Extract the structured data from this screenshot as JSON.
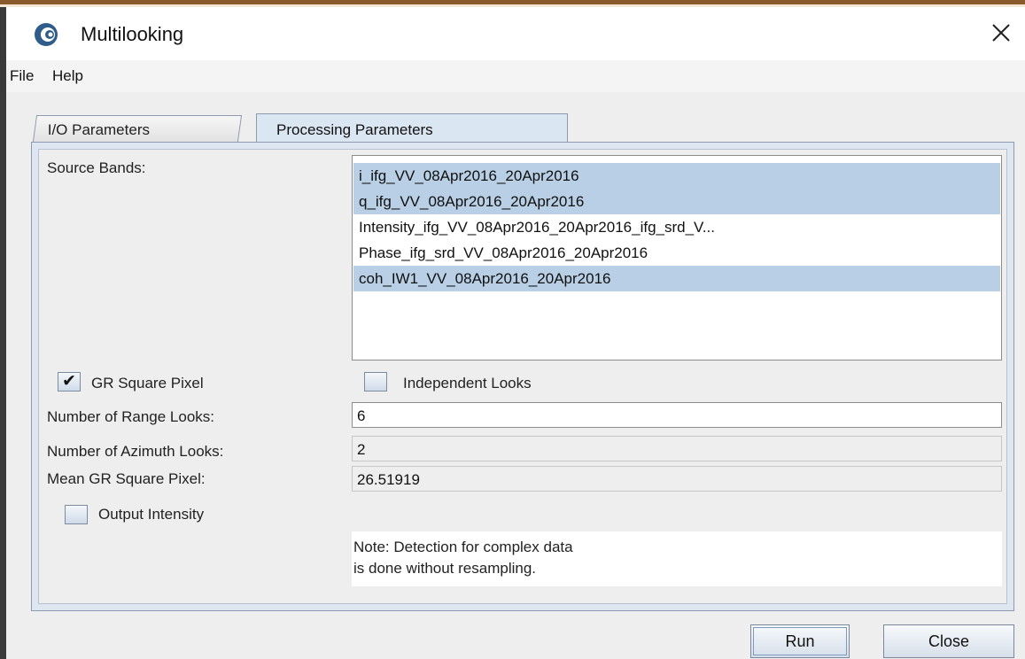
{
  "window": {
    "title": "Multilooking",
    "icons": {
      "app": "esa-snap-icon",
      "close": "close-icon"
    }
  },
  "menu": {
    "items": [
      "File",
      "Help"
    ]
  },
  "tabs": [
    {
      "label": "I/O Parameters",
      "selected": false
    },
    {
      "label": "Processing Parameters",
      "selected": true
    }
  ],
  "processing": {
    "source_bands_label": "Source Bands:",
    "source_bands": [
      {
        "name": "i_ifg_VV_08Apr2016_20Apr2016",
        "selected": true
      },
      {
        "name": "q_ifg_VV_08Apr2016_20Apr2016",
        "selected": true
      },
      {
        "name": "Intensity_ifg_VV_08Apr2016_20Apr2016_ifg_srd_V...",
        "selected": false
      },
      {
        "name": "Phase_ifg_srd_VV_08Apr2016_20Apr2016",
        "selected": false
      },
      {
        "name": "coh_IW1_VV_08Apr2016_20Apr2016",
        "selected": true
      }
    ],
    "gr_square_pixel": {
      "label": "GR Square Pixel",
      "checked": true
    },
    "independent_looks": {
      "label": "Independent Looks",
      "checked": false
    },
    "range_looks": {
      "label": "Number of Range Looks:",
      "value": "6"
    },
    "azimuth_looks": {
      "label": "Number of Azimuth Looks:",
      "value": "2"
    },
    "mean_gr_square_pixel": {
      "label": "Mean GR Square Pixel:",
      "value": "26.51919"
    },
    "output_intensity": {
      "label": "Output Intensity",
      "checked": false
    },
    "note_line1": "Note: Detection for complex data",
    "note_line2": "is done without resampling."
  },
  "buttons": {
    "run": "Run",
    "close": "Close"
  },
  "colors": {
    "selection": "#b8cfe5",
    "tab_panel": "#dde6f1",
    "title_accent": "#8a5a2b"
  }
}
